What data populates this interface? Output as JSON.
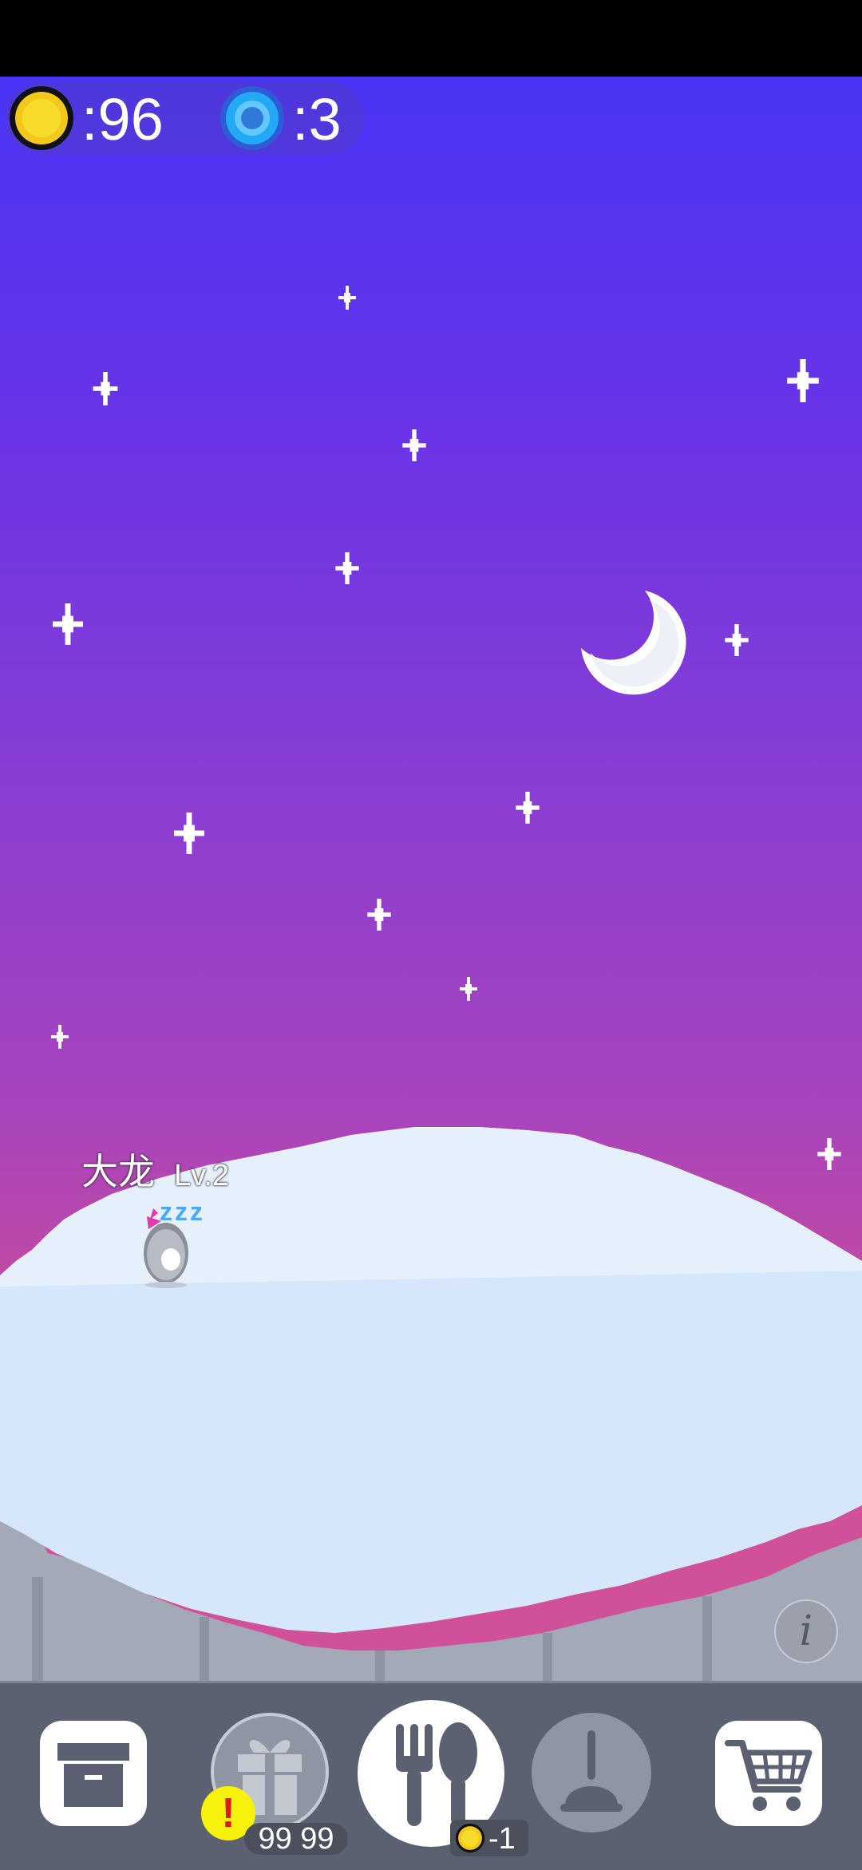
{
  "currency": {
    "coins_label": ":96",
    "gems_label": ":3",
    "coin_icon": "gold-coin-icon",
    "gem_icon": "blue-gem-icon"
  },
  "pet": {
    "name": "大龙",
    "level": "Lv.2",
    "state_text": "zzz"
  },
  "toolbar": {
    "storage_icon": "storage-box-icon",
    "gift_icon": "gift-icon",
    "gift_count": "99 99",
    "gift_alert": "!",
    "feed_icon": "fork-spoon-icon",
    "feed_cost": "-1",
    "clean_icon": "plunger-icon",
    "shop_icon": "shopping-cart-icon"
  },
  "info_label": "i",
  "colors": {
    "sky_top": "#4a34f6",
    "sky_bottom": "#d0509a",
    "ground": "#d6e7fc",
    "toolbar": "#5b6170",
    "zzz": "#4aa8ff",
    "alert": "#f7f20c"
  }
}
